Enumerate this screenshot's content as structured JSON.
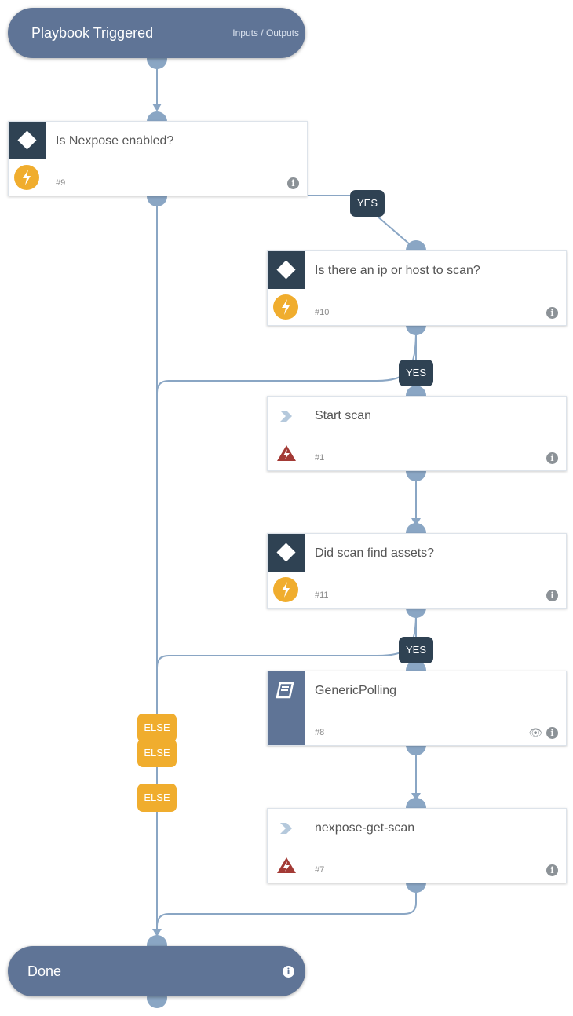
{
  "start": {
    "title": "Playbook Triggered",
    "link": "Inputs / Outputs"
  },
  "end": {
    "title": "Done"
  },
  "tasks": [
    {
      "id": "#9",
      "title": "Is Nexpose enabled?",
      "type": "condition",
      "status_icon": "bolt-icon"
    },
    {
      "id": "#10",
      "title": "Is there an ip or host to scan?",
      "type": "condition",
      "status_icon": "bolt-icon"
    },
    {
      "id": "#1",
      "title": "Start scan",
      "type": "command",
      "status_icon": "warning-bolt-icon"
    },
    {
      "id": "#11",
      "title": "Did scan find assets?",
      "type": "condition",
      "status_icon": "bolt-icon"
    },
    {
      "id": "#8",
      "title": "GenericPolling",
      "type": "playbook",
      "status_icon": "book-icon"
    },
    {
      "id": "#7",
      "title": "nexpose-get-scan",
      "type": "command",
      "status_icon": "warning-bolt-icon"
    }
  ],
  "labels": {
    "yes": "YES",
    "else": "ELSE",
    "info": "i"
  },
  "colors": {
    "pill": "#5f7496",
    "condition": "#2f4253",
    "bolt": "#f0ad2e",
    "warning": "#a33a35",
    "edge": "#8aa6c4"
  }
}
